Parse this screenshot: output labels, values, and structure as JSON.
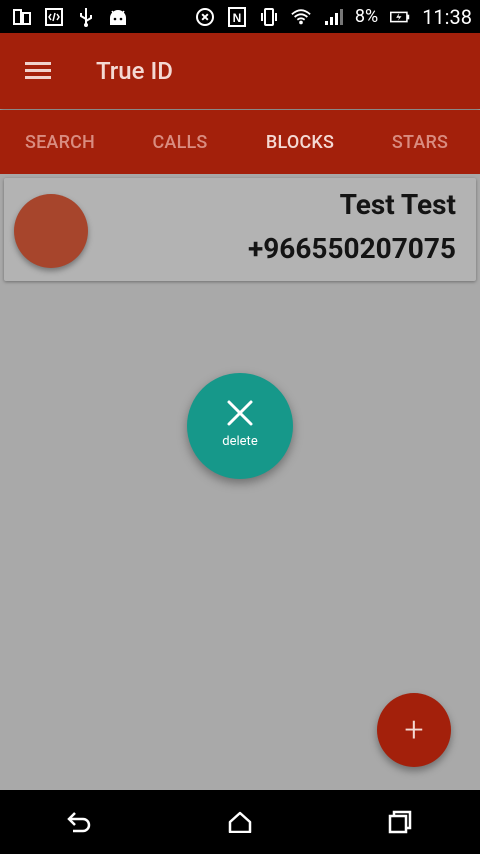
{
  "status_bar": {
    "battery": "8%",
    "time": "11:38",
    "icons_left": [
      "dual-window-icon",
      "code-icon",
      "usb-icon",
      "android-icon"
    ],
    "icons_right": [
      "nfc-sync-icon",
      "nfc-icon",
      "vibrate-icon",
      "wifi-icon",
      "signal-icon",
      "battery-charging-icon"
    ]
  },
  "toolbar": {
    "title": "True ID",
    "menu_icon": "hamburger-menu-icon"
  },
  "tabs": [
    {
      "label": "SEARCH",
      "active": false
    },
    {
      "label": "CALLS",
      "active": false
    },
    {
      "label": "BLOCKS",
      "active": true
    },
    {
      "label": "STARS",
      "active": false
    }
  ],
  "blocked_list": [
    {
      "name": "Test Test",
      "number": "+966550207075"
    }
  ],
  "delete_fab": {
    "label": "delete",
    "icon": "close-icon"
  },
  "add_fab": {
    "icon": "plus-icon",
    "symbol": "+"
  },
  "colors": {
    "primary": "#a3200b",
    "accent": "#16988a",
    "avatar": "#a7452c",
    "dim_background": "#a9a9a9"
  },
  "navbar": {
    "icons": [
      "back-icon",
      "home-icon",
      "recents-icon"
    ]
  }
}
